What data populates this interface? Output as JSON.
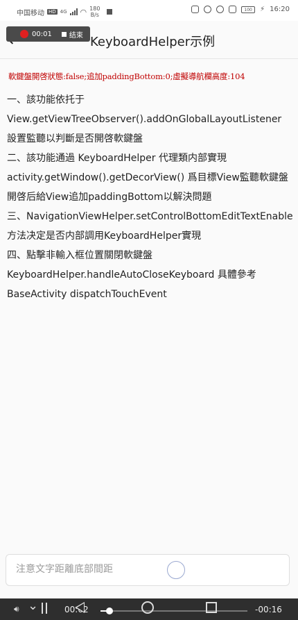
{
  "status_bar": {
    "carrier": "中国移动",
    "hd": "HD",
    "network": "4G",
    "speed_value": "180",
    "speed_unit": "B/s",
    "battery": "100",
    "time": "16:20"
  },
  "recorder": {
    "elapsed": "00:01",
    "end_label": "结束"
  },
  "header": {
    "title": "KeyboardHelper示例"
  },
  "keyboard_status": "軟鍵盤開啓狀態:false;追加paddingBottom:0;虛擬導航欄高度:104",
  "description": [
    "一、該功能依托于",
    "View.getViewTreeObserver().addOnGlobalLayoutListener 設置監聽以判斷是否開啓軟鍵盤",
    " 二、該功能通過 KeyboardHelper 代理類内部實現 activity.getWindow().getDecorView() 爲目標View監聽軟鍵盤開啓后給View追加paddingBottom以解決問題",
    " 三、NavigationViewHelper.setControlBottomEditTextEnable 方法决定是否内部調用KeyboardHelper實現",
    " 四、點擊非輸入框位置關閉軟鍵盤",
    "KeyboardHelper.handleAutoCloseKeyboard 具體參考BaseActivity dispatchTouchEvent"
  ],
  "input": {
    "placeholder": "注意文字距離底部間距",
    "value": ""
  },
  "player": {
    "current_time": "00:02",
    "remaining_time": "-00:16",
    "progress": 0.06
  }
}
